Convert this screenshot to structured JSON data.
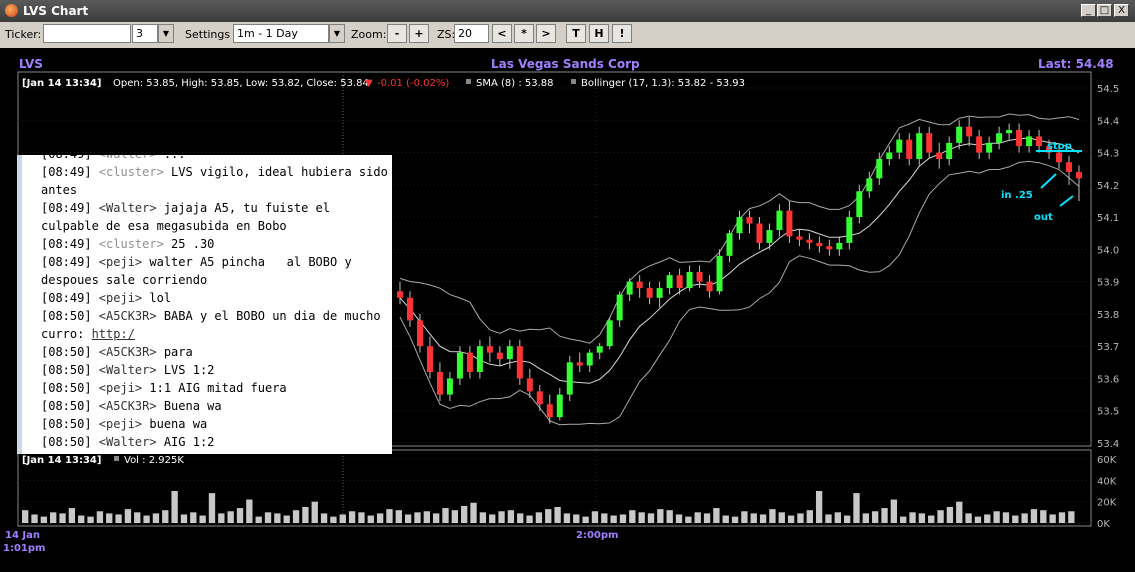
{
  "window": {
    "title": "LVS Chart",
    "controls": [
      "_",
      "□",
      "X"
    ]
  },
  "toolbar": {
    "ticker_label": "Ticker:",
    "ticker_value": "",
    "ticker_count": "3",
    "settings_label": "Settings",
    "settings_value": "1m - 1 Day",
    "zoom_label": "Zoom:",
    "zoom_out": "-",
    "zoom_in": "+",
    "zs_label": "ZS:",
    "zs_value": "20",
    "nav_prev": "<",
    "nav_center": "*",
    "nav_next": ">",
    "t_btn": "T",
    "h_btn": "H",
    "excl_btn": "!"
  },
  "header": {
    "symbol": "LVS",
    "company": "Las Vegas Sands Corp",
    "last": "Last: 54.48"
  },
  "info_line": {
    "timestamp": "[Jan 14 13:34]",
    "ohlc": "Open: 53.85, High: 53.85, Low: 53.82, Close: 53.84",
    "change": "-0.01 (-0.02%)",
    "sma": "SMA (8) : 53.88",
    "bollinger": "Bollinger (17, 1.3): 53.82 - 53.93"
  },
  "volume_info": {
    "timestamp": "[Jan 14 13:34]",
    "vol": "Vol : 2.925K"
  },
  "colors": {
    "up": "#33ff33",
    "down": "#ff3333",
    "header": "#a080ff",
    "axis": "#b8b8b8",
    "annotation": "#00e5ff"
  },
  "chart_data": {
    "type": "candlestick",
    "y_ticks": [
      "54.5",
      "54.4",
      "54.3",
      "54.2",
      "54.1",
      "54.0",
      "53.9",
      "53.8",
      "53.7",
      "53.6",
      "53.5",
      "53.4"
    ],
    "y_range": [
      53.4,
      54.5
    ],
    "vol_ticks": [
      "60K",
      "40K",
      "20K",
      "0K"
    ],
    "vol_range": [
      0,
      60
    ],
    "x_labels": [
      "14 Jan",
      "1:01pm",
      "2:00pm"
    ],
    "annotations": [
      "stop",
      "in .25",
      "out"
    ],
    "candles": [
      [
        53.87,
        53.85,
        53.9,
        53.83
      ],
      [
        53.85,
        53.78,
        53.87,
        53.76
      ],
      [
        53.78,
        53.7,
        53.8,
        53.68
      ],
      [
        53.7,
        53.62,
        53.73,
        53.6
      ],
      [
        53.62,
        53.55,
        53.65,
        53.53
      ],
      [
        53.55,
        53.6,
        53.62,
        53.53
      ],
      [
        53.6,
        53.68,
        53.7,
        53.58
      ],
      [
        53.68,
        53.62,
        53.7,
        53.6
      ],
      [
        53.62,
        53.7,
        53.72,
        53.6
      ],
      [
        53.7,
        53.68,
        53.73,
        53.65
      ],
      [
        53.68,
        53.66,
        53.7,
        53.64
      ],
      [
        53.66,
        53.7,
        53.72,
        53.63
      ],
      [
        53.7,
        53.6,
        53.72,
        53.58
      ],
      [
        53.6,
        53.56,
        53.63,
        53.54
      ],
      [
        53.56,
        53.52,
        53.58,
        53.5
      ],
      [
        53.52,
        53.48,
        53.55,
        53.46
      ],
      [
        53.48,
        53.55,
        53.57,
        53.47
      ],
      [
        53.55,
        53.65,
        53.67,
        53.53
      ],
      [
        53.65,
        53.64,
        53.68,
        53.62
      ],
      [
        53.64,
        53.68,
        53.69,
        53.62
      ],
      [
        53.68,
        53.7,
        53.71,
        53.66
      ],
      [
        53.7,
        53.78,
        53.79,
        53.69
      ],
      [
        53.78,
        53.86,
        53.87,
        53.76
      ],
      [
        53.86,
        53.9,
        53.91,
        53.84
      ],
      [
        53.9,
        53.88,
        53.92,
        53.85
      ],
      [
        53.88,
        53.85,
        53.9,
        53.83
      ],
      [
        53.85,
        53.88,
        53.9,
        53.82
      ],
      [
        53.88,
        53.92,
        53.93,
        53.86
      ],
      [
        53.92,
        53.88,
        53.94,
        53.86
      ],
      [
        53.88,
        53.93,
        53.95,
        53.87
      ],
      [
        53.93,
        53.9,
        53.95,
        53.88
      ],
      [
        53.9,
        53.87,
        53.92,
        53.85
      ],
      [
        53.87,
        53.98,
        54.0,
        53.86
      ],
      [
        53.98,
        54.05,
        54.06,
        53.96
      ],
      [
        54.05,
        54.1,
        54.12,
        54.03
      ],
      [
        54.1,
        54.08,
        54.12,
        54.05
      ],
      [
        54.08,
        54.02,
        54.1,
        54.0
      ],
      [
        54.02,
        54.06,
        54.08,
        54.0
      ],
      [
        54.06,
        54.12,
        54.14,
        54.04
      ],
      [
        54.12,
        54.04,
        54.15,
        54.02
      ],
      [
        54.04,
        54.03,
        54.06,
        54.01
      ],
      [
        54.03,
        54.02,
        54.05,
        54.0
      ],
      [
        54.02,
        54.01,
        54.04,
        53.99
      ],
      [
        54.01,
        54.0,
        54.03,
        53.98
      ],
      [
        54.0,
        54.02,
        54.04,
        53.98
      ],
      [
        54.02,
        54.1,
        54.12,
        54.0
      ],
      [
        54.1,
        54.18,
        54.2,
        54.08
      ],
      [
        54.18,
        54.22,
        54.24,
        54.16
      ],
      [
        54.22,
        54.28,
        54.3,
        54.2
      ],
      [
        54.28,
        54.3,
        54.32,
        54.26
      ],
      [
        54.3,
        54.34,
        54.36,
        54.28
      ],
      [
        54.34,
        54.28,
        54.36,
        54.26
      ],
      [
        54.28,
        54.36,
        54.38,
        54.26
      ],
      [
        54.36,
        54.3,
        54.38,
        54.28
      ],
      [
        54.3,
        54.28,
        54.33,
        54.25
      ],
      [
        54.28,
        54.33,
        54.35,
        54.26
      ],
      [
        54.33,
        54.38,
        54.4,
        54.31
      ],
      [
        54.38,
        54.35,
        54.41,
        54.32
      ],
      [
        54.35,
        54.3,
        54.37,
        54.28
      ],
      [
        54.3,
        54.33,
        54.35,
        54.28
      ],
      [
        54.33,
        54.36,
        54.38,
        54.31
      ],
      [
        54.36,
        54.37,
        54.39,
        54.34
      ],
      [
        54.37,
        54.32,
        54.39,
        54.3
      ],
      [
        54.32,
        54.35,
        54.37,
        54.3
      ],
      [
        54.35,
        54.32,
        54.37,
        54.3
      ],
      [
        54.32,
        54.3,
        54.34,
        54.28
      ],
      [
        54.3,
        54.27,
        54.32,
        54.25
      ],
      [
        54.27,
        54.24,
        54.29,
        54.2
      ],
      [
        54.24,
        54.22,
        54.26,
        54.15
      ]
    ],
    "volume_k": [
      12,
      8,
      6,
      10,
      9,
      14,
      7,
      6,
      11,
      9,
      8,
      13,
      10,
      7,
      9,
      12,
      30,
      8,
      10,
      7,
      28,
      9,
      11,
      14,
      22,
      6,
      10,
      9,
      7,
      12,
      15,
      20,
      9,
      6,
      8,
      11,
      10,
      7,
      9,
      13,
      12,
      8,
      10,
      11,
      9,
      14,
      12,
      16,
      19,
      10,
      8,
      11,
      12,
      9,
      7,
      10,
      13,
      15,
      9,
      8,
      6,
      11,
      9,
      7,
      8,
      12,
      10,
      9,
      13
    ]
  }
}
